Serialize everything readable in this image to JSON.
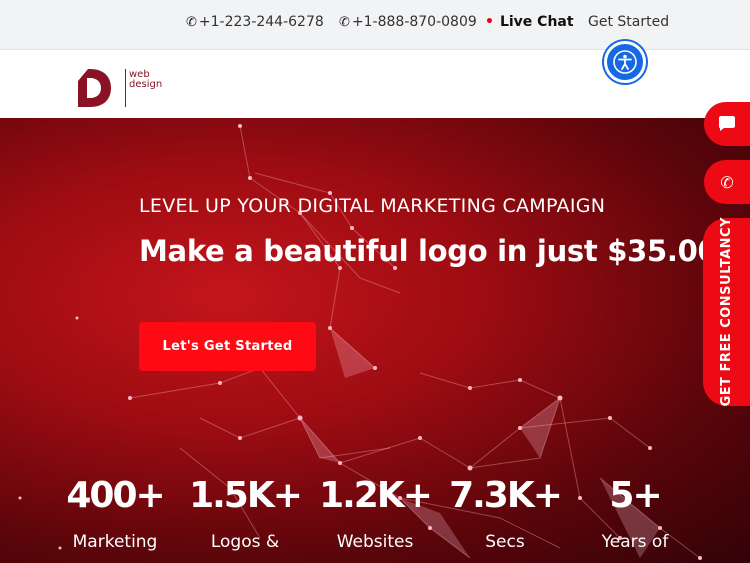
{
  "topbar": {
    "phone1": "+1-223-244-6278",
    "phone2": "+1-888-870-0809",
    "live_chat": "Live Chat",
    "get_started": "Get Started"
  },
  "header": {
    "logo_line1": "web",
    "logo_line2": "design"
  },
  "hero": {
    "subtitle": "LEVEL UP YOUR DIGITAL MARKETING CAMPAIGN",
    "title": "Make a beautiful logo in just $35.00",
    "cta": "Let's Get Started"
  },
  "stats": [
    {
      "number": "400+",
      "label": "Marketing"
    },
    {
      "number": "1.5K+",
      "label": "Logos &"
    },
    {
      "number": "1.2K+",
      "label": "Websites"
    },
    {
      "number": "7.3K+",
      "label": "Secs"
    },
    {
      "number": "5+",
      "label": "Years of"
    }
  ],
  "side": {
    "consult": "GET FREE CONSULTANCY"
  },
  "colors": {
    "accent": "#ee0a14",
    "brand": "#8b1224",
    "accessibility": "#1668e3"
  }
}
